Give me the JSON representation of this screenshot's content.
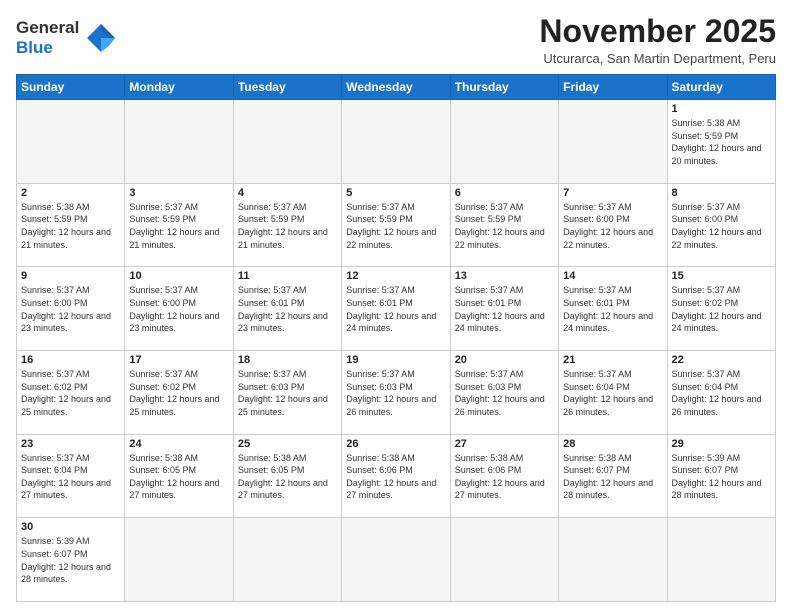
{
  "logo": {
    "line1": "General",
    "line2": "Blue"
  },
  "title": "November 2025",
  "subtitle": "Utcurarca, San Martin Department, Peru",
  "days_of_week": [
    "Sunday",
    "Monday",
    "Tuesday",
    "Wednesday",
    "Thursday",
    "Friday",
    "Saturday"
  ],
  "weeks": [
    [
      {
        "day": "",
        "info": "",
        "empty": true
      },
      {
        "day": "",
        "info": "",
        "empty": true
      },
      {
        "day": "",
        "info": "",
        "empty": true
      },
      {
        "day": "",
        "info": "",
        "empty": true
      },
      {
        "day": "",
        "info": "",
        "empty": true
      },
      {
        "day": "",
        "info": "",
        "empty": true
      },
      {
        "day": "1",
        "info": "Sunrise: 5:38 AM\nSunset: 5:59 PM\nDaylight: 12 hours\nand 20 minutes.",
        "empty": false
      }
    ],
    [
      {
        "day": "2",
        "info": "Sunrise: 5:38 AM\nSunset: 5:59 PM\nDaylight: 12 hours\nand 21 minutes.",
        "empty": false
      },
      {
        "day": "3",
        "info": "Sunrise: 5:37 AM\nSunset: 5:59 PM\nDaylight: 12 hours\nand 21 minutes.",
        "empty": false
      },
      {
        "day": "4",
        "info": "Sunrise: 5:37 AM\nSunset: 5:59 PM\nDaylight: 12 hours\nand 21 minutes.",
        "empty": false
      },
      {
        "day": "5",
        "info": "Sunrise: 5:37 AM\nSunset: 5:59 PM\nDaylight: 12 hours\nand 22 minutes.",
        "empty": false
      },
      {
        "day": "6",
        "info": "Sunrise: 5:37 AM\nSunset: 5:59 PM\nDaylight: 12 hours\nand 22 minutes.",
        "empty": false
      },
      {
        "day": "7",
        "info": "Sunrise: 5:37 AM\nSunset: 6:00 PM\nDaylight: 12 hours\nand 22 minutes.",
        "empty": false
      },
      {
        "day": "8",
        "info": "Sunrise: 5:37 AM\nSunset: 6:00 PM\nDaylight: 12 hours\nand 22 minutes.",
        "empty": false
      }
    ],
    [
      {
        "day": "9",
        "info": "Sunrise: 5:37 AM\nSunset: 6:00 PM\nDaylight: 12 hours\nand 23 minutes.",
        "empty": false
      },
      {
        "day": "10",
        "info": "Sunrise: 5:37 AM\nSunset: 6:00 PM\nDaylight: 12 hours\nand 23 minutes.",
        "empty": false
      },
      {
        "day": "11",
        "info": "Sunrise: 5:37 AM\nSunset: 6:01 PM\nDaylight: 12 hours\nand 23 minutes.",
        "empty": false
      },
      {
        "day": "12",
        "info": "Sunrise: 5:37 AM\nSunset: 6:01 PM\nDaylight: 12 hours\nand 24 minutes.",
        "empty": false
      },
      {
        "day": "13",
        "info": "Sunrise: 5:37 AM\nSunset: 6:01 PM\nDaylight: 12 hours\nand 24 minutes.",
        "empty": false
      },
      {
        "day": "14",
        "info": "Sunrise: 5:37 AM\nSunset: 6:01 PM\nDaylight: 12 hours\nand 24 minutes.",
        "empty": false
      },
      {
        "day": "15",
        "info": "Sunrise: 5:37 AM\nSunset: 6:02 PM\nDaylight: 12 hours\nand 24 minutes.",
        "empty": false
      }
    ],
    [
      {
        "day": "16",
        "info": "Sunrise: 5:37 AM\nSunset: 6:02 PM\nDaylight: 12 hours\nand 25 minutes.",
        "empty": false
      },
      {
        "day": "17",
        "info": "Sunrise: 5:37 AM\nSunset: 6:02 PM\nDaylight: 12 hours\nand 25 minutes.",
        "empty": false
      },
      {
        "day": "18",
        "info": "Sunrise: 5:37 AM\nSunset: 6:03 PM\nDaylight: 12 hours\nand 25 minutes.",
        "empty": false
      },
      {
        "day": "19",
        "info": "Sunrise: 5:37 AM\nSunset: 6:03 PM\nDaylight: 12 hours\nand 26 minutes.",
        "empty": false
      },
      {
        "day": "20",
        "info": "Sunrise: 5:37 AM\nSunset: 6:03 PM\nDaylight: 12 hours\nand 26 minutes.",
        "empty": false
      },
      {
        "day": "21",
        "info": "Sunrise: 5:37 AM\nSunset: 6:04 PM\nDaylight: 12 hours\nand 26 minutes.",
        "empty": false
      },
      {
        "day": "22",
        "info": "Sunrise: 5:37 AM\nSunset: 6:04 PM\nDaylight: 12 hours\nand 26 minutes.",
        "empty": false
      }
    ],
    [
      {
        "day": "23",
        "info": "Sunrise: 5:37 AM\nSunset: 6:04 PM\nDaylight: 12 hours\nand 27 minutes.",
        "empty": false
      },
      {
        "day": "24",
        "info": "Sunrise: 5:38 AM\nSunset: 6:05 PM\nDaylight: 12 hours\nand 27 minutes.",
        "empty": false
      },
      {
        "day": "25",
        "info": "Sunrise: 5:38 AM\nSunset: 6:05 PM\nDaylight: 12 hours\nand 27 minutes.",
        "empty": false
      },
      {
        "day": "26",
        "info": "Sunrise: 5:38 AM\nSunset: 6:06 PM\nDaylight: 12 hours\nand 27 minutes.",
        "empty": false
      },
      {
        "day": "27",
        "info": "Sunrise: 5:38 AM\nSunset: 6:06 PM\nDaylight: 12 hours\nand 27 minutes.",
        "empty": false
      },
      {
        "day": "28",
        "info": "Sunrise: 5:38 AM\nSunset: 6:07 PM\nDaylight: 12 hours\nand 28 minutes.",
        "empty": false
      },
      {
        "day": "29",
        "info": "Sunrise: 5:39 AM\nSunset: 6:07 PM\nDaylight: 12 hours\nand 28 minutes.",
        "empty": false
      }
    ],
    [
      {
        "day": "30",
        "info": "Sunrise: 5:39 AM\nSunset: 6:07 PM\nDaylight: 12 hours\nand 28 minutes.",
        "empty": false
      },
      {
        "day": "",
        "info": "",
        "empty": true
      },
      {
        "day": "",
        "info": "",
        "empty": true
      },
      {
        "day": "",
        "info": "",
        "empty": true
      },
      {
        "day": "",
        "info": "",
        "empty": true
      },
      {
        "day": "",
        "info": "",
        "empty": true
      },
      {
        "day": "",
        "info": "",
        "empty": true
      }
    ]
  ]
}
